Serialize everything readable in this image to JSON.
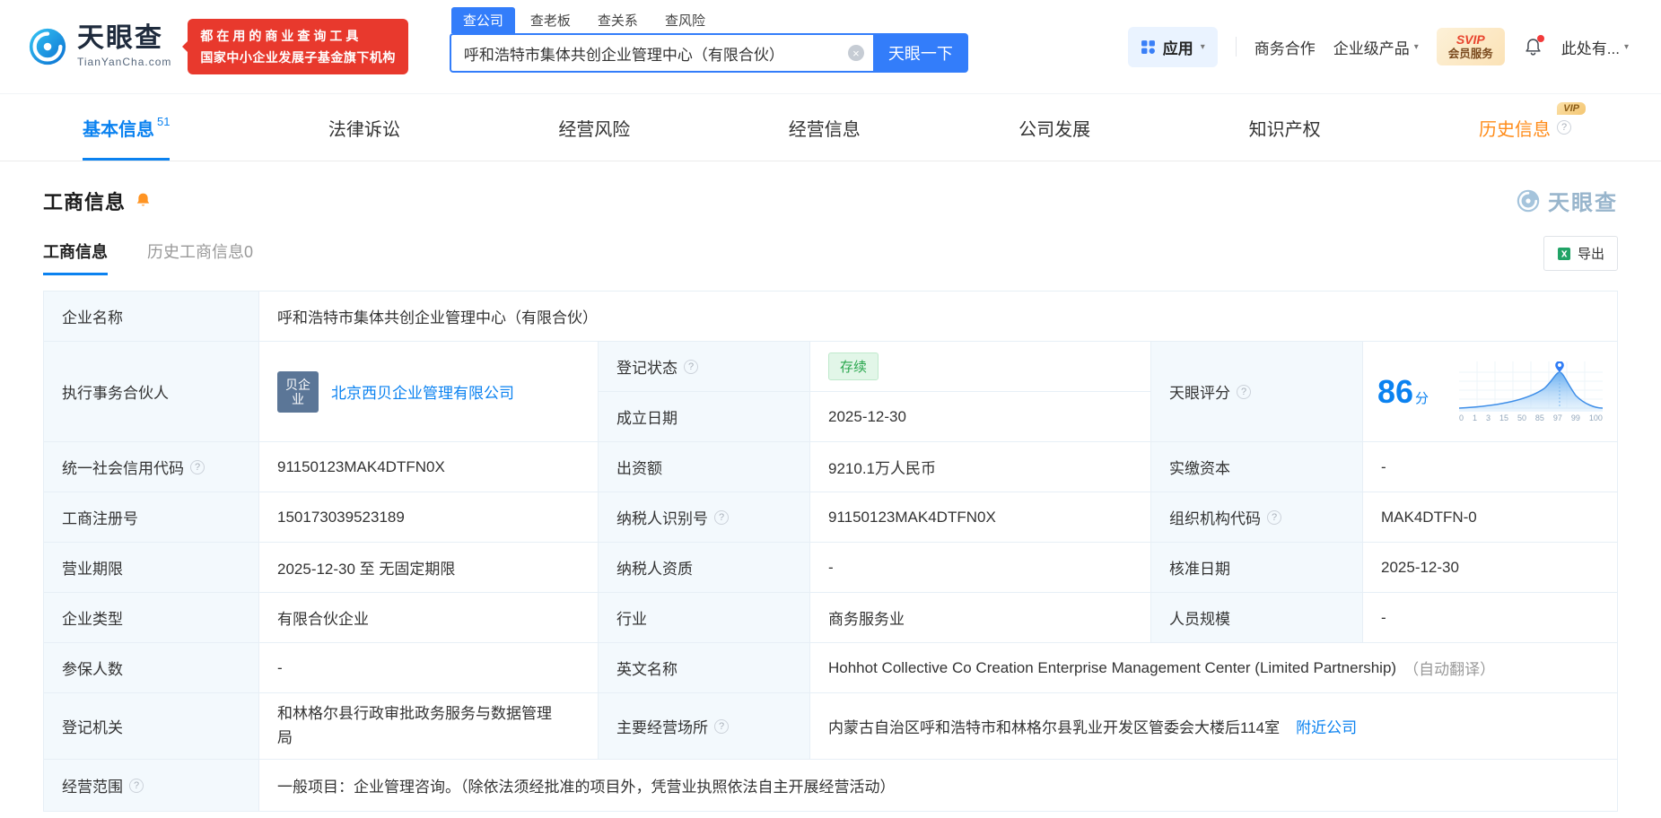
{
  "colors": {
    "brand_blue": "#0b82f0",
    "button_blue": "#337dfa",
    "promo_red": "#e8392d",
    "status_green": "#2aa74e",
    "status_green_bg": "#e2f6e8",
    "vip_orange": "#ff8c1a",
    "label_cell_bg": "#f3f9fd"
  },
  "header": {
    "logo": {
      "brand": "天眼查",
      "domain": "TianYanCha.com"
    },
    "promo": {
      "line1": "都在用的商业查询工具",
      "line2": "国家中小企业发展子基金旗下机构"
    },
    "search": {
      "tabs": [
        {
          "label": "查公司"
        },
        {
          "label": "查老板"
        },
        {
          "label": "查关系"
        },
        {
          "label": "查风险"
        }
      ],
      "value": "呼和浩特市集体共创企业管理中心（有限合伙）",
      "button": "天眼一下"
    },
    "nav": {
      "app": "应用",
      "cooperation": "商务合作",
      "enterprise": "企业级产品",
      "svip_line1": "SVIP",
      "svip_line2": "会员服务",
      "user": "此处有..."
    }
  },
  "tabs": [
    {
      "label": "基本信息",
      "count": "51"
    },
    {
      "label": "法律诉讼"
    },
    {
      "label": "经营风险"
    },
    {
      "label": "经营信息"
    },
    {
      "label": "公司发展"
    },
    {
      "label": "知识产权"
    },
    {
      "label": "历史信息",
      "vip": "VIP"
    }
  ],
  "section": {
    "title": "工商信息",
    "watermark": "天眼查",
    "subtabs": [
      {
        "label": "工商信息"
      },
      {
        "label": "历史工商信息",
        "count": "0"
      }
    ],
    "export_label": "导出"
  },
  "fields": {
    "company_name": {
      "label": "企业名称",
      "value": "呼和浩特市集体共创企业管理中心（有限合伙）"
    },
    "executive_partner": {
      "label": "执行事务合伙人",
      "logo_text": "贝企业",
      "value": "北京西贝企业管理有限公司"
    },
    "reg_status": {
      "label": "登记状态",
      "value": "存续"
    },
    "establish_date": {
      "label": "成立日期",
      "value": "2025-12-30"
    },
    "tyc_score": {
      "label": "天眼评分",
      "value": "86",
      "unit": "分"
    },
    "credit_code": {
      "label": "统一社会信用代码",
      "value": "91150123MAK4DTFN0X"
    },
    "capital": {
      "label": "出资额",
      "value": "9210.1万人民币"
    },
    "paid_capital": {
      "label": "实缴资本",
      "value": "-"
    },
    "reg_number": {
      "label": "工商注册号",
      "value": "150173039523189"
    },
    "taxpayer_id": {
      "label": "纳税人识别号",
      "value": "91150123MAK4DTFN0X"
    },
    "org_code": {
      "label": "组织机构代码",
      "value": "MAK4DTFN-0"
    },
    "business_term": {
      "label": "营业期限",
      "value": "2025-12-30 至 无固定期限"
    },
    "taxpayer_quality": {
      "label": "纳税人资质",
      "value": "-"
    },
    "approval_date": {
      "label": "核准日期",
      "value": "2025-12-30"
    },
    "company_type": {
      "label": "企业类型",
      "value": "有限合伙企业"
    },
    "industry": {
      "label": "行业",
      "value": "商务服务业"
    },
    "staff_size": {
      "label": "人员规模",
      "value": "-"
    },
    "insured_count": {
      "label": "参保人数",
      "value": "-"
    },
    "english_name": {
      "label": "英文名称",
      "value": "Hohhot Collective Co Creation Enterprise Management Center (Limited Partnership)",
      "note": "（自动翻译）"
    },
    "reg_authority": {
      "label": "登记机关",
      "value": "和林格尔县行政审批政务服务与数据管理局"
    },
    "business_address": {
      "label": "主要经营场所",
      "value": "内蒙古自治区呼和浩特市和林格尔县乳业开发区管委会大楼后114室",
      "link": "附近公司"
    },
    "business_scope": {
      "label": "经营范围",
      "value": "一般项目：企业管理咨询。（除依法须经批准的项目外，凭营业执照依法自主开展经营活动）"
    }
  },
  "score_chart": {
    "axis": [
      "0",
      "1",
      "3",
      "15",
      "50",
      "85",
      "97",
      "99",
      "100"
    ]
  }
}
